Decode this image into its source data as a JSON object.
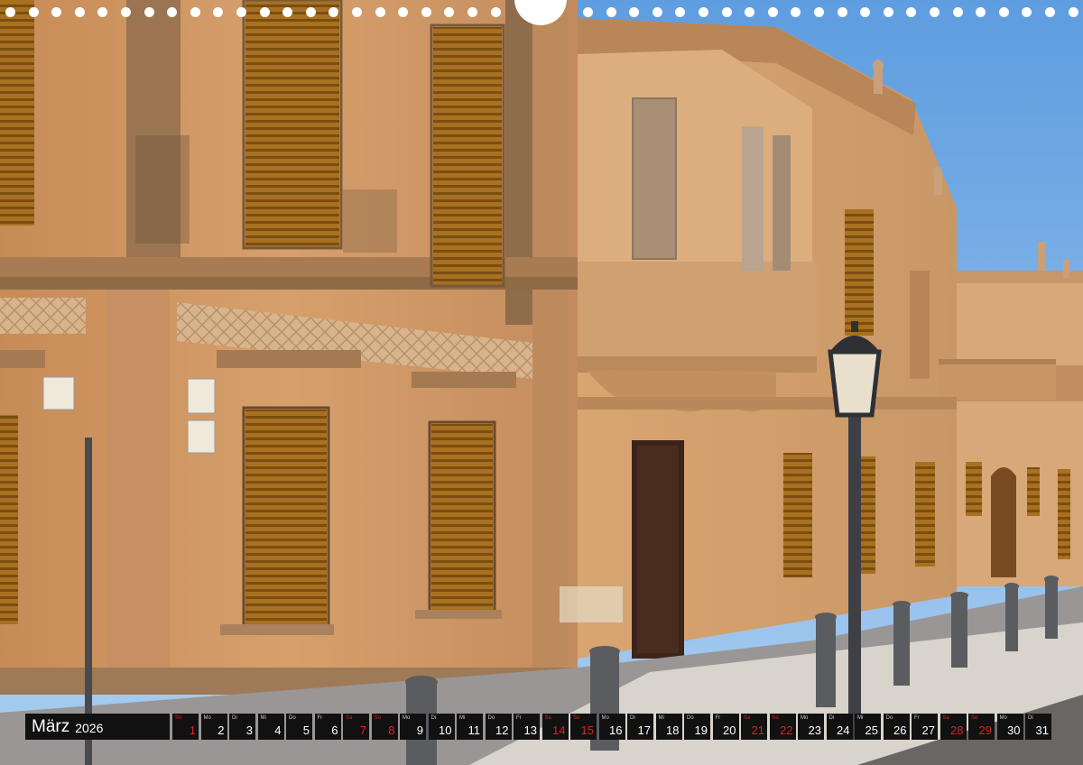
{
  "calendar": {
    "month": "März",
    "year": "2026",
    "days": [
      {
        "n": "1",
        "wd": "So",
        "red": true
      },
      {
        "n": "2",
        "wd": "Mo",
        "red": false
      },
      {
        "n": "3",
        "wd": "Di",
        "red": false
      },
      {
        "n": "4",
        "wd": "Mi",
        "red": false
      },
      {
        "n": "5",
        "wd": "Do",
        "red": false
      },
      {
        "n": "6",
        "wd": "Fr",
        "red": false
      },
      {
        "n": "7",
        "wd": "Sa",
        "red": true
      },
      {
        "n": "8",
        "wd": "So",
        "red": true
      },
      {
        "n": "9",
        "wd": "Mo",
        "red": false
      },
      {
        "n": "10",
        "wd": "Di",
        "red": false
      },
      {
        "n": "11",
        "wd": "Mi",
        "red": false
      },
      {
        "n": "12",
        "wd": "Do",
        "red": false
      },
      {
        "n": "13",
        "wd": "Fr",
        "red": false
      },
      {
        "n": "14",
        "wd": "Sa",
        "red": true
      },
      {
        "n": "15",
        "wd": "So",
        "red": true
      },
      {
        "n": "16",
        "wd": "Mo",
        "red": false
      },
      {
        "n": "17",
        "wd": "Di",
        "red": false
      },
      {
        "n": "18",
        "wd": "Mi",
        "red": false
      },
      {
        "n": "19",
        "wd": "Do",
        "red": false
      },
      {
        "n": "20",
        "wd": "Fr",
        "red": false
      },
      {
        "n": "21",
        "wd": "Sa",
        "red": true
      },
      {
        "n": "22",
        "wd": "So",
        "red": true
      },
      {
        "n": "23",
        "wd": "Mo",
        "red": false
      },
      {
        "n": "24",
        "wd": "Di",
        "red": false
      },
      {
        "n": "25",
        "wd": "Mi",
        "red": false
      },
      {
        "n": "26",
        "wd": "Do",
        "red": false
      },
      {
        "n": "27",
        "wd": "Fr",
        "red": false
      },
      {
        "n": "28",
        "wd": "Sa",
        "red": true
      },
      {
        "n": "29",
        "wd": "So",
        "red": true
      },
      {
        "n": "30",
        "wd": "Mo",
        "red": false
      },
      {
        "n": "31",
        "wd": "Di",
        "red": false
      }
    ]
  },
  "signs": {
    "sign1": "",
    "sign2": "",
    "sign3": ""
  },
  "colors": {
    "sky": "#7fb3e6",
    "stone": "#c98f5c",
    "shutter": "#a86d1c",
    "weekend": "#e0201f"
  }
}
